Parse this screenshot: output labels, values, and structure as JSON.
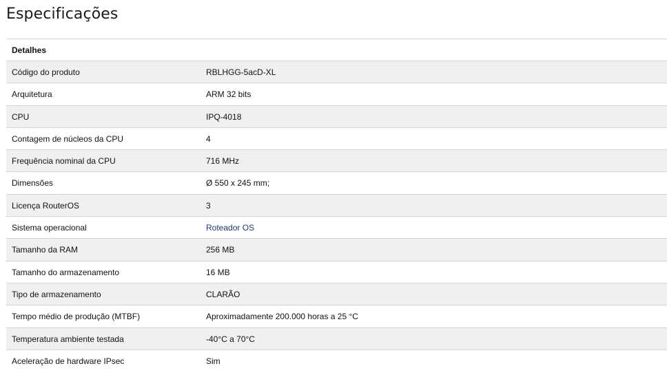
{
  "page": {
    "title": "Especificações"
  },
  "table": {
    "header": "Detalhes",
    "rows": [
      {
        "label": "Código do produto",
        "value": "RBLHGG-5acD-XL"
      },
      {
        "label": "Arquitetura",
        "value": "ARM 32 bits"
      },
      {
        "label": "CPU",
        "value": "IPQ-4018"
      },
      {
        "label": "Contagem de núcleos da CPU",
        "value": "4"
      },
      {
        "label": "Frequência nominal da CPU",
        "value": "716 MHz"
      },
      {
        "label": "Dimensões",
        "value": "Ø 550 x 245 mm;"
      },
      {
        "label": "Licença RouterOS",
        "value": "3"
      },
      {
        "label": "Sistema operacional",
        "value": "Roteador OS"
      },
      {
        "label": "Tamanho da RAM",
        "value": "256 MB"
      },
      {
        "label": "Tamanho do armazenamento",
        "value": "16 MB"
      },
      {
        "label": "Tipo de armazenamento",
        "value": "CLARÃO"
      },
      {
        "label": "Tempo médio de produção (MTBF)",
        "value": "Aproximadamente 200.000 horas a 25 °C"
      },
      {
        "label": "Temperatura ambiente testada",
        "value": "-40°C a 70°C"
      },
      {
        "label": "Aceleração de hardware IPsec",
        "value": "Sim"
      }
    ]
  },
  "colors": {
    "row_alt": "#f0f0f0",
    "border": "#d5d5d5",
    "link": "#1c3a6e"
  }
}
